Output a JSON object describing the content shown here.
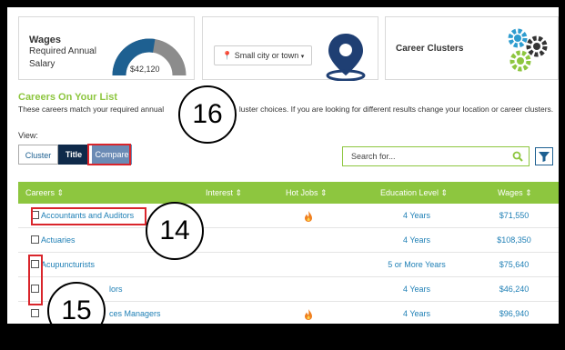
{
  "wages_card": {
    "title": "Wages",
    "subtitle_line1": "Required Annual",
    "subtitle_line2": "Salary",
    "gauge_value": "$42,120",
    "gauge_fill_fraction": 0.45,
    "colors": {
      "fill": "#1e6091",
      "track": "#8c8c8c"
    }
  },
  "location_card": {
    "dropdown_value": "Small city or town",
    "pin_icon": "map-pin-icon"
  },
  "clusters_card": {
    "title": "Career Clusters",
    "gears_icon": "gears-icon"
  },
  "list_section": {
    "title": "Careers On Your List",
    "description_left": "These careers match your required annual",
    "description_right": "luster choices. If you are looking for different results change your location or career clusters."
  },
  "view": {
    "label": "View:",
    "buttons": [
      "Cluster",
      "Title",
      "Compare"
    ],
    "active": "Title"
  },
  "search": {
    "placeholder": "Search for..."
  },
  "table": {
    "headers": {
      "careers": "Careers ⇕",
      "interest": "Interest ⇕",
      "hot_jobs": "Hot Jobs ⇕",
      "education": "Education Level ⇕",
      "wages": "Wages ⇕"
    },
    "rows": [
      {
        "career": "Accountants and Auditors",
        "hot_job": true,
        "education": "4 Years",
        "wages": "$71,550"
      },
      {
        "career": "Actuaries",
        "hot_job": false,
        "education": "4 Years",
        "wages": "$108,350"
      },
      {
        "career": "Acupuncturists",
        "hot_job": false,
        "education": "5 or More Years",
        "wages": "$75,640"
      },
      {
        "career": "lors",
        "hot_job": false,
        "education": "4 Years",
        "wages": "$46,240"
      },
      {
        "career": "ces Managers",
        "hot_job": true,
        "education": "4 Years",
        "wages": "$96,940"
      }
    ]
  },
  "callouts": [
    "16",
    "14",
    "15"
  ],
  "colors": {
    "accent_green": "#8dc63f",
    "link_blue": "#1e7fb5",
    "dark_navy": "#0f2a4a",
    "highlight_red": "#d9252b",
    "flame_orange": "#f08020"
  }
}
